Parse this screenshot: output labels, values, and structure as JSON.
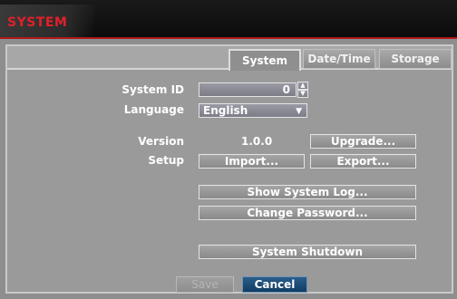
{
  "window": {
    "title": "SYSTEM"
  },
  "tabs": [
    {
      "label": "System",
      "active": true
    },
    {
      "label": "Date/Time",
      "active": false
    },
    {
      "label": "Storage",
      "active": false
    }
  ],
  "form": {
    "system_id": {
      "label": "System ID",
      "value": "0"
    },
    "language": {
      "label": "Language",
      "value": "English"
    },
    "version": {
      "label": "Version",
      "value": "1.0.0"
    },
    "setup": {
      "label": "Setup"
    }
  },
  "buttons": {
    "upgrade": "Upgrade...",
    "import": "Import...",
    "export": "Export...",
    "show_system_log": "Show System Log...",
    "change_password": "Change Password...",
    "system_shutdown": "System Shutdown",
    "save": "Save",
    "cancel": "Cancel"
  },
  "icons": {
    "spinner_up": "triangle-up-icon",
    "spinner_down": "triangle-down-icon",
    "dropdown": "chevron-down-icon"
  },
  "colors": {
    "title": "#e0202a",
    "accent_button": "#123c63",
    "panel": "#9a9a9a"
  }
}
